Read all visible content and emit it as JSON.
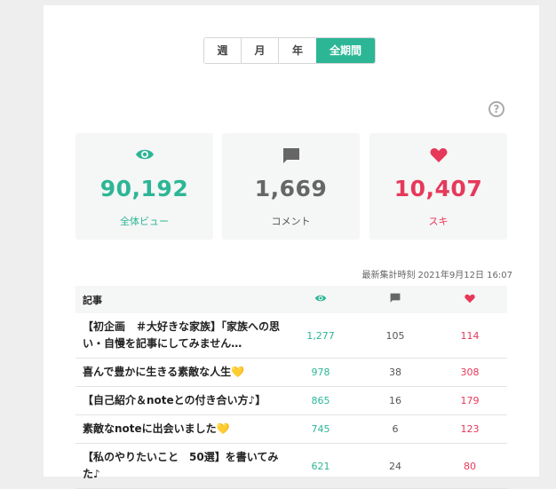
{
  "period_tabs": [
    {
      "label": "週",
      "active": false
    },
    {
      "label": "月",
      "active": false
    },
    {
      "label": "年",
      "active": false
    },
    {
      "label": "全期間",
      "active": true
    }
  ],
  "help_icon": "question-circle-icon",
  "summary": {
    "views": {
      "icon": "eye-icon",
      "value": "90,192",
      "label": "全体ビュー"
    },
    "comments": {
      "icon": "comment-icon",
      "value": "1,669",
      "label": "コメント"
    },
    "likes": {
      "icon": "heart-icon",
      "value": "10,407",
      "label": "スキ"
    }
  },
  "last_updated": {
    "label": "最新集計時刻",
    "value": "2021年9月12日 16:07"
  },
  "table": {
    "header": {
      "title": "記事",
      "views_icon": "eye-icon",
      "comments_icon": "comment-icon",
      "likes_icon": "heart-icon"
    },
    "rows": [
      {
        "title": "【初企画　＃大好きな家族】「家族への思い・自慢を記事にしてみません…",
        "views": "1,277",
        "comments": "105",
        "likes": "114"
      },
      {
        "title": "喜んで豊かに生きる素敵な人生",
        "heart": "💛",
        "views": "978",
        "comments": "38",
        "likes": "308"
      },
      {
        "title": "【自己紹介＆noteとの付き合い方♪】",
        "views": "865",
        "comments": "16",
        "likes": "179"
      },
      {
        "title": "素敵なnoteに出会いました",
        "heart": "💛",
        "views": "745",
        "comments": "6",
        "likes": "123"
      },
      {
        "title": "【私のやりたいこと　50選】を書いてみた♪",
        "views": "621",
        "comments": "24",
        "likes": "80"
      }
    ]
  },
  "colors": {
    "green": "#2cb696",
    "red": "#e6395a",
    "gray": "#666666"
  }
}
